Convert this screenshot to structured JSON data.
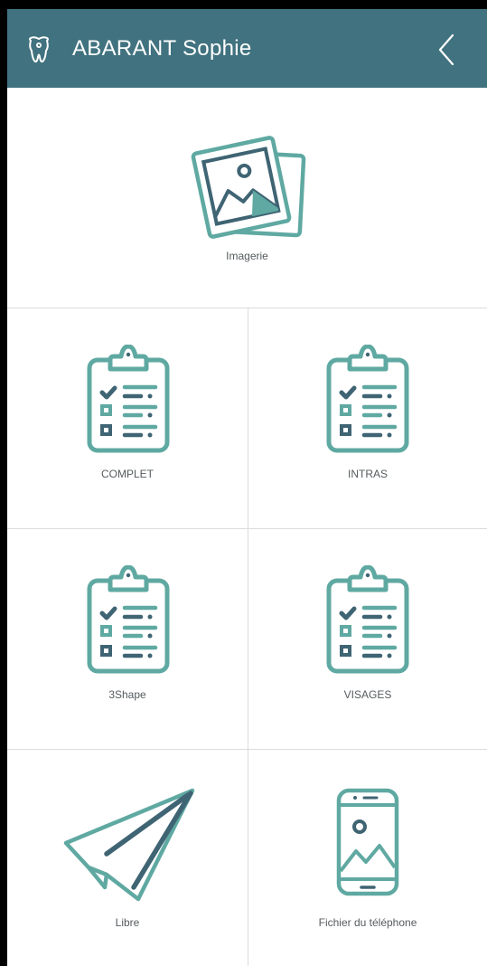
{
  "header": {
    "title": "ABARANT Sophie",
    "app_icon": "tooth-icon",
    "back_icon": "chevron-left-icon",
    "background": "#41727f"
  },
  "colors": {
    "icon_teal": "#5fa9a2",
    "icon_dark": "#3f6473"
  },
  "tiles": [
    {
      "label": "Imagerie",
      "icon": "photos-icon"
    },
    {
      "label": "COMPLET",
      "icon": "clipboard-checklist-icon"
    },
    {
      "label": "INTRAS",
      "icon": "clipboard-checklist-icon"
    },
    {
      "label": "3Shape",
      "icon": "clipboard-checklist-icon"
    },
    {
      "label": "VISAGES",
      "icon": "clipboard-checklist-icon"
    },
    {
      "label": "Libre",
      "icon": "paper-plane-icon"
    },
    {
      "label": "Fichier du téléphone",
      "icon": "phone-gallery-icon"
    }
  ]
}
